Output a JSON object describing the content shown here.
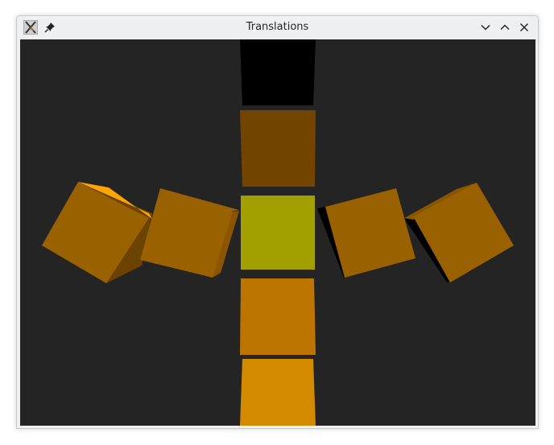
{
  "window": {
    "title": "Translations"
  },
  "titlebar": {
    "app_icon": "x-app-icon",
    "pin_icon": "pin-icon",
    "minimize_icon": "chevron-down-icon",
    "maximize_icon": "chevron-up-icon",
    "close_icon": "close-icon"
  },
  "scene": {
    "background": "#242424",
    "colors": {
      "dark": "#000000",
      "brown": "#714500",
      "olive": "#a2a000",
      "orange_mid": "#bd7400",
      "orange_bright": "#d38900",
      "cube_face": "#9a6100",
      "cube_top": "#ffa500",
      "cube_shadow": "#6b4200"
    }
  }
}
